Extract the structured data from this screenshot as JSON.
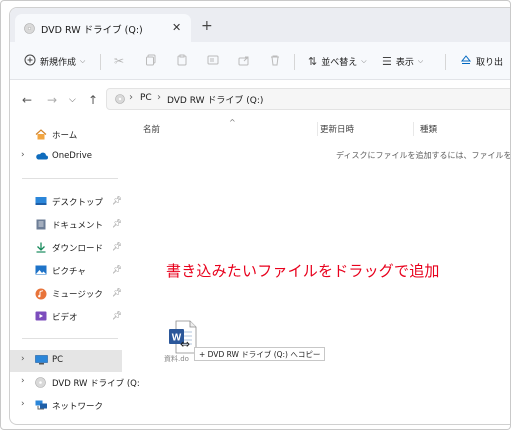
{
  "tab": {
    "title": "DVD RW ドライブ (Q:)",
    "close": "✕",
    "new_tab": "+"
  },
  "toolbar": {
    "new_label": "新規作成",
    "sort_label": "並べ替え",
    "view_label": "表示",
    "eject_label": "取り出"
  },
  "breadcrumb": {
    "pc": "PC",
    "drive": "DVD RW ドライブ (Q:)"
  },
  "sidebar": {
    "home": "ホーム",
    "onedrive": "OneDrive",
    "desktop": "デスクトップ",
    "documents": "ドキュメント",
    "downloads": "ダウンロード",
    "pictures": "ピクチャ",
    "music": "ミュージック",
    "videos": "ビデオ",
    "pc": "PC",
    "dvd": "DVD RW ドライブ (Q:",
    "network": "ネットワーク"
  },
  "columns": {
    "name": "名前",
    "modified": "更新日時",
    "type": "種類"
  },
  "empty_message": "ディスクにファイルを追加するには、ファイルをこのフォル",
  "annotation": "書き込みたいファイルをドラッグで追加",
  "drag": {
    "tooltip": "+ DVD RW ドライブ (Q:) へコピー",
    "file_name": "資料.do"
  },
  "colors": {
    "accent": "#0067c0",
    "annotation": "#e8001c",
    "word_blue": "#2b579a",
    "selected_bg": "#e5e5e5"
  }
}
